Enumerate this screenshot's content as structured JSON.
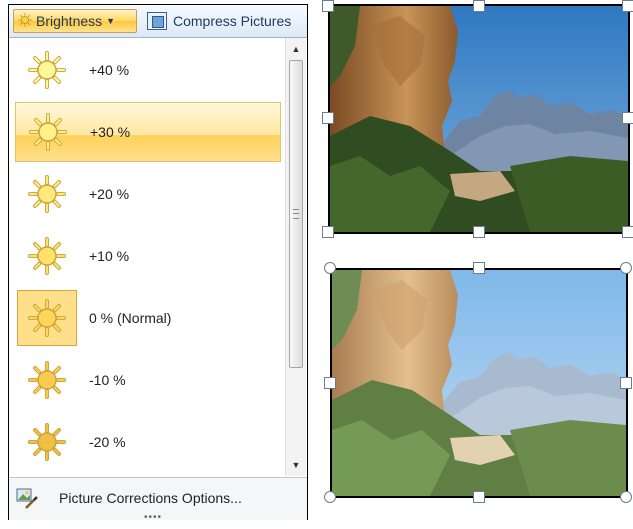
{
  "ribbon": {
    "brightness_label": "Brightness",
    "compress_label": "Compress Pictures"
  },
  "brightness_options": [
    {
      "label": "+40 %",
      "state": "normal"
    },
    {
      "label": "+30 %",
      "state": "hover"
    },
    {
      "label": "+20 %",
      "state": "normal"
    },
    {
      "label": "+10 %",
      "state": "normal"
    },
    {
      "label": "0 % (Normal)",
      "state": "selected"
    },
    {
      "label": "-10 %",
      "state": "normal"
    },
    {
      "label": "-20 %",
      "state": "normal"
    }
  ],
  "footer": {
    "options_label": "Picture Corrections Options..."
  },
  "icons": {
    "sun": "sun-icon",
    "compress": "compress-pictures-icon",
    "corrections": "picture-corrections-icon",
    "scroll_up": "scroll-up-icon",
    "scroll_down": "scroll-down-icon"
  },
  "colors": {
    "hover_highlight": "#ffd15a",
    "selected_bg": "#ffdf8a",
    "ribbon_text": "#1e395b",
    "sky": "#3f86c8",
    "sky_bright": "#8bc1ee"
  }
}
